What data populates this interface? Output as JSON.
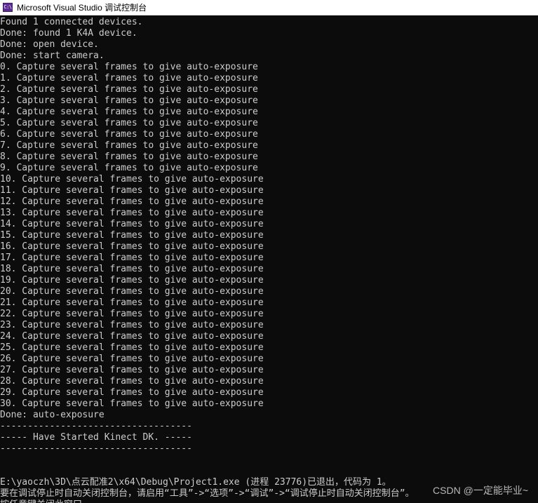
{
  "window": {
    "title": "Microsoft Visual Studio 调试控制台",
    "icon": "visual-studio-console-icon",
    "icon_glyph": "C:\\"
  },
  "console": {
    "lines": [
      "Found 1 connected devices.",
      "Done: found 1 K4A device.",
      "Done: open device.",
      "Done: start camera.",
      "0. Capture several frames to give auto-exposure",
      "1. Capture several frames to give auto-exposure",
      "2. Capture several frames to give auto-exposure",
      "3. Capture several frames to give auto-exposure",
      "4. Capture several frames to give auto-exposure",
      "5. Capture several frames to give auto-exposure",
      "6. Capture several frames to give auto-exposure",
      "7. Capture several frames to give auto-exposure",
      "8. Capture several frames to give auto-exposure",
      "9. Capture several frames to give auto-exposure",
      "10. Capture several frames to give auto-exposure",
      "11. Capture several frames to give auto-exposure",
      "12. Capture several frames to give auto-exposure",
      "13. Capture several frames to give auto-exposure",
      "14. Capture several frames to give auto-exposure",
      "15. Capture several frames to give auto-exposure",
      "16. Capture several frames to give auto-exposure",
      "17. Capture several frames to give auto-exposure",
      "18. Capture several frames to give auto-exposure",
      "19. Capture several frames to give auto-exposure",
      "20. Capture several frames to give auto-exposure",
      "21. Capture several frames to give auto-exposure",
      "22. Capture several frames to give auto-exposure",
      "23. Capture several frames to give auto-exposure",
      "24. Capture several frames to give auto-exposure",
      "25. Capture several frames to give auto-exposure",
      "26. Capture several frames to give auto-exposure",
      "27. Capture several frames to give auto-exposure",
      "28. Capture several frames to give auto-exposure",
      "29. Capture several frames to give auto-exposure",
      "30. Capture several frames to give auto-exposure",
      "Done: auto-exposure",
      "-----------------------------------",
      "----- Have Started Kinect DK. -----",
      "-----------------------------------",
      "",
      "",
      "E:\\yaoczh\\3D\\点云配准2\\x64\\Debug\\Project1.exe (进程 23776)已退出，代码为 1。",
      "要在调试停止时自动关闭控制台，请启用“工具”->“选项”->“调试”->“调试停止时自动关闭控制台”。",
      "按任意键关闭此窗口. . ."
    ]
  },
  "watermark": {
    "text": "CSDN @一定能毕业~"
  },
  "colors": {
    "console_background": "#0c0c0c",
    "console_text": "#cccccc",
    "titlebar_background": "#ffffff",
    "titlebar_text": "#000000",
    "icon_accent": "#5c2d91"
  }
}
